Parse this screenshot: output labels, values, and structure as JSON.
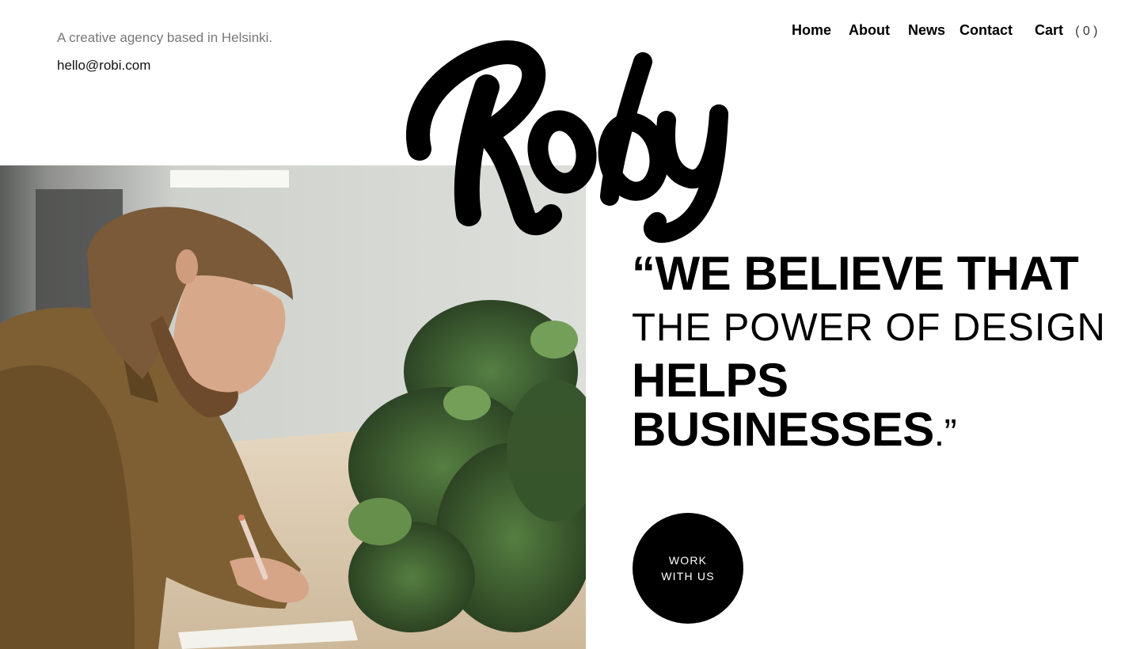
{
  "header": {
    "tagline": "A creative agency based in Helsinki.",
    "email": "hello@robi.com"
  },
  "nav": {
    "items": [
      "Home",
      "About",
      "News",
      "Contact"
    ],
    "cart_label": "Cart",
    "cart_count": "( 0 )"
  },
  "logo": {
    "text": "Roby"
  },
  "hero": {
    "quote_line1": "“WE BELIEVE THAT",
    "quote_line2": "THE POWER OF DESIGN",
    "quote_line3": "HELPS",
    "quote_line4": "BUSINESSES",
    "quote_close": ".”",
    "cta_line1": "WORK",
    "cta_line2": "WITH US"
  },
  "image": {
    "subject": "man-writing-at-desk-with-plants"
  },
  "colors": {
    "text": "#000000",
    "muted": "#777777",
    "background": "#ffffff",
    "button": "#000000"
  }
}
